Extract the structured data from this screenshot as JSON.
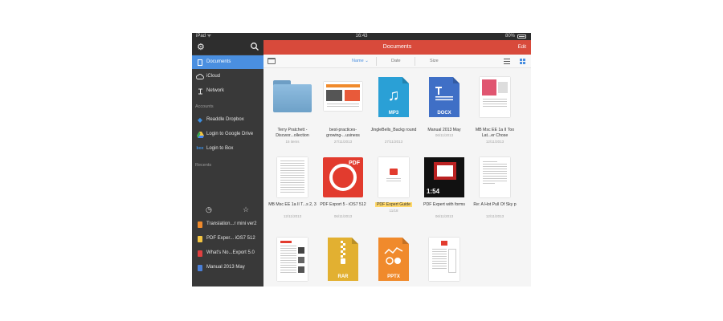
{
  "status_bar": {
    "carrier": "iPad ᯤ",
    "time": "16:43",
    "battery": "80%"
  },
  "sidebar": {
    "icons": {
      "settings": "gear-icon",
      "search": "search-icon"
    },
    "items": [
      {
        "label": "Documents",
        "icon": "document-icon",
        "active": true
      },
      {
        "label": "iCloud",
        "icon": "cloud-icon",
        "active": false
      },
      {
        "label": "Network",
        "icon": "network-icon",
        "active": false
      }
    ],
    "accounts_header": "Accounts",
    "accounts": [
      {
        "label": "Readdle Dropbox",
        "icon": "dropbox-icon"
      },
      {
        "label": "Login to Google Drive",
        "icon": "google-drive-icon"
      },
      {
        "label": "Login to Box",
        "icon": "box-icon"
      }
    ],
    "recents_header": "Recents",
    "recents": [
      {
        "label": "Translation...r mini ver2",
        "color": "#f08a2c"
      },
      {
        "label": "PDF Exper... iOS7 512",
        "color": "#f4c542"
      },
      {
        "label": "What's No...Export 5.0",
        "color": "#e04040"
      },
      {
        "label": "Manual 2013 May",
        "color": "#4a7fd8"
      }
    ]
  },
  "header": {
    "title": "Documents",
    "edit_label": "Edit"
  },
  "toolbar": {
    "sort_options": [
      {
        "label": "Name ⌄",
        "active": true
      },
      {
        "label": "Date",
        "active": false
      },
      {
        "label": "Size",
        "active": false
      }
    ]
  },
  "files": [
    {
      "name": "Terry Pratchett - Discwor...ollection",
      "meta": "15 items",
      "kind": "folder"
    },
    {
      "name": "best-practices-growing-...usiness",
      "meta": "27/11/2013",
      "kind": "doc-image"
    },
    {
      "name": "JingleBells_Backg round",
      "meta": "27/11/2013",
      "kind": "mp3",
      "label": "MP3",
      "color": "#2aa0d6"
    },
    {
      "name": "Manual 2013 May",
      "meta": "06/11/2013",
      "kind": "docx",
      "label": "DOCX",
      "color": "#3f6fc6"
    },
    {
      "name": "MB Msc EE 1a II Too Lat...er Chose",
      "meta": "12/11/2013",
      "kind": "doc-pink"
    },
    {
      "name": "MB Msc EE 1a II T...s 2, 3",
      "meta": "12/11/2013",
      "kind": "doc-text"
    },
    {
      "name": "PDF Export 5 - iOS7 512",
      "meta": "06/11/2013",
      "kind": "pdf-app",
      "label": "PDF"
    },
    {
      "name": "PDF Expert Guide",
      "meta": "11/18",
      "kind": "doc-red-logo",
      "highlight": true
    },
    {
      "name": "PDF Expert with forms",
      "meta": "06/11/2013",
      "kind": "video",
      "label": "1:54"
    },
    {
      "name": "Re: A Hot Pull Of Sky p",
      "meta": "12/11/2013",
      "kind": "doc-letter"
    },
    {
      "name": "",
      "meta": "",
      "kind": "doc-article"
    },
    {
      "name": "",
      "meta": "",
      "kind": "rar",
      "label": "RAR",
      "color": "#e2b031"
    },
    {
      "name": "",
      "meta": "",
      "kind": "pptx",
      "label": "PPTX",
      "color": "#f08a2c"
    },
    {
      "name": "",
      "meta": "",
      "kind": "doc-form"
    }
  ]
}
